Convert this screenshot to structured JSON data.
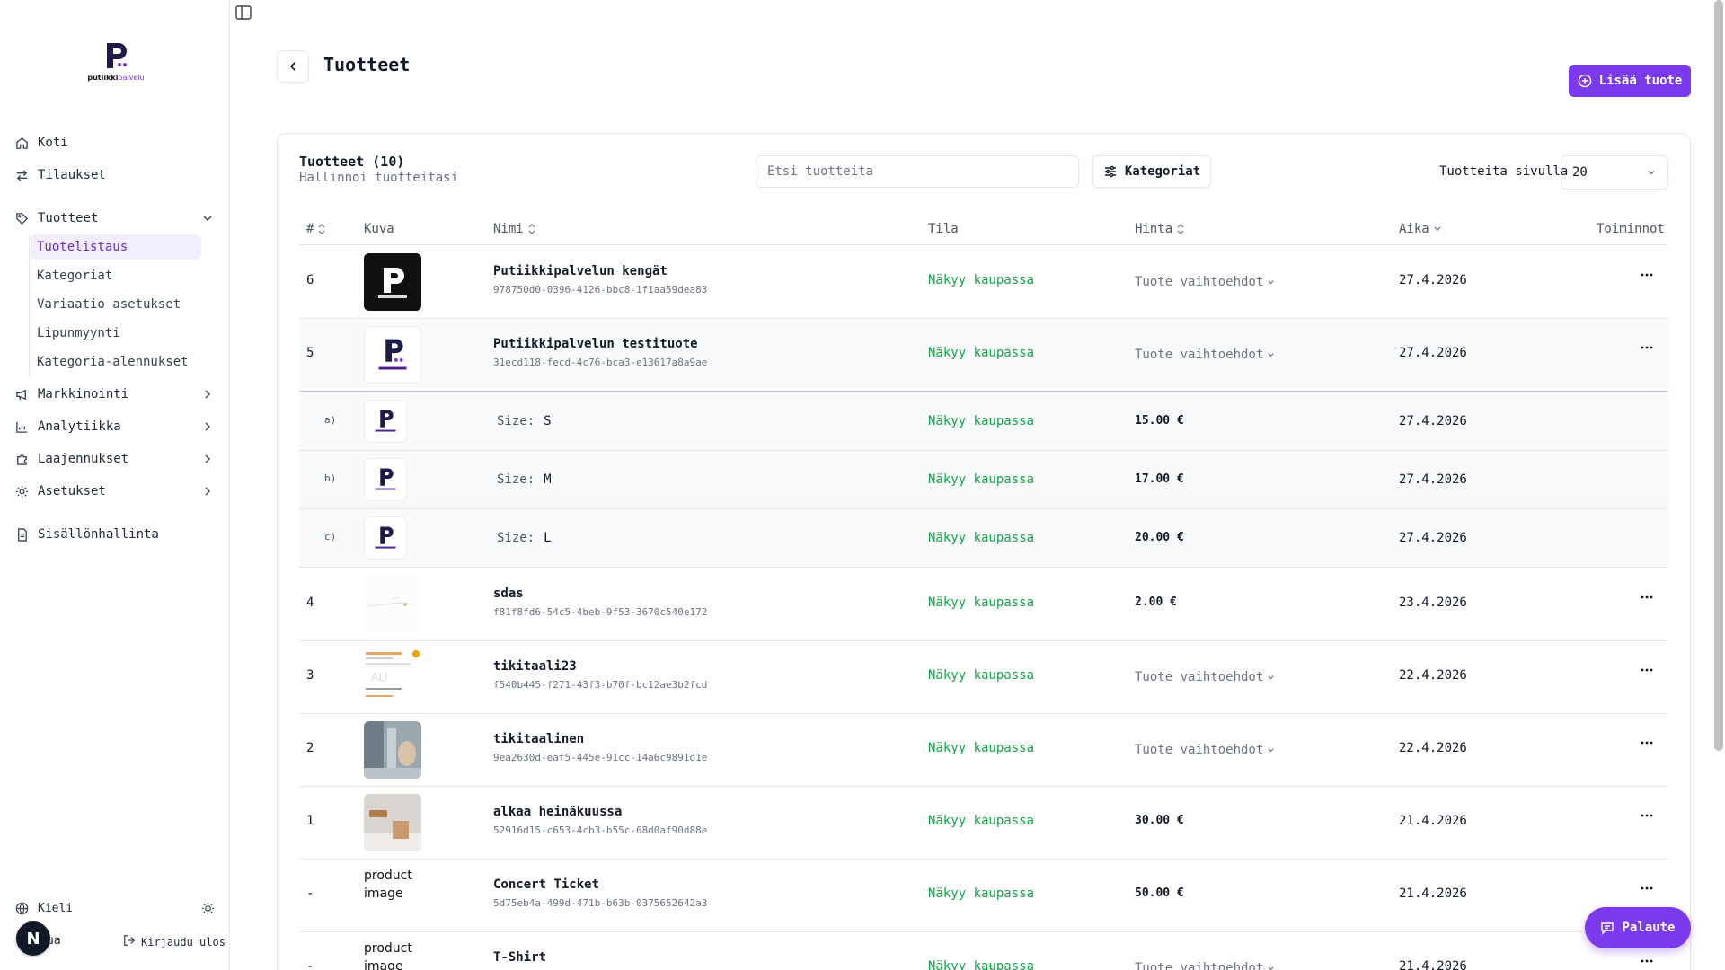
{
  "brand": {
    "logo_text_a": "putiikki",
    "logo_text_b": "palvelu"
  },
  "sidebar": {
    "items": [
      {
        "label": "Koti",
        "icon": "home-icon"
      },
      {
        "label": "Tilaukset",
        "icon": "arrows-icon"
      },
      {
        "label": "Tuotteet",
        "icon": "tag-icon"
      },
      {
        "label": "Markkinointi",
        "icon": "megaphone-icon"
      },
      {
        "label": "Analytiikka",
        "icon": "bar-chart-icon"
      },
      {
        "label": "Laajennukset",
        "icon": "puzzle-icon"
      },
      {
        "label": "Asetukset",
        "icon": "gear-icon"
      },
      {
        "label": "Sisällönhallinta",
        "icon": "document-icon"
      }
    ],
    "sub_items": [
      "Tuotelistaus",
      "Kategoriat",
      "Variaatio asetukset",
      "Lipunmyynti",
      "Kategoria-alennukset"
    ],
    "language_label": "Kieli",
    "user_label_partial": "ua",
    "logout_label": "Kirjaudu ulos",
    "avatar_letter": "N"
  },
  "header": {
    "title": "Tuotteet",
    "add_button": "Lisää tuote"
  },
  "card": {
    "title": "Tuotteet (10)",
    "subtitle": "Hallinnoi tuotteitasi",
    "search_placeholder": "Etsi tuotteita",
    "categories_button": "Kategoriat",
    "per_page_label": "Tuotteita sivulla",
    "per_page_value": "20"
  },
  "table": {
    "columns": [
      "#",
      "Kuva",
      "Nimi",
      "Tila",
      "Hinta",
      "Aika",
      "Toiminnot"
    ],
    "rows": [
      {
        "num": "6",
        "name": "Putiikkipalvelun kengät",
        "id": "978750d0-0396-4126-bbc8-1f1aa59dea83",
        "status": "Näkyy kaupassa",
        "price": "Tuote vaihtoehdot",
        "date": "27.4.2026"
      },
      {
        "num": "5",
        "name": "Putiikkipalvelun testituote",
        "id": "31ecd118-fecd-4c76-bca3-e13617a8a9ae",
        "status": "Näkyy kaupassa",
        "price": "Tuote vaihtoehdot",
        "date": "27.4.2026"
      },
      {
        "num": "4",
        "name": "sdas",
        "id": "f81f8fd6-54c5-4beb-9f53-3670c540e172",
        "status": "Näkyy kaupassa",
        "price": "2.00 €",
        "date": "23.4.2026"
      },
      {
        "num": "3",
        "name": "tikitaali23",
        "id": "f540b445-f271-43f3-b70f-bc12ae3b2fcd",
        "status": "Näkyy kaupassa",
        "price": "Tuote vaihtoehdot",
        "date": "22.4.2026"
      },
      {
        "num": "2",
        "name": "tikitaalinen",
        "id": "9ea2630d-eaf5-445e-91cc-14a6c9891d1e",
        "status": "Näkyy kaupassa",
        "price": "Tuote vaihtoehdot",
        "date": "22.4.2026"
      },
      {
        "num": "1",
        "name": "alkaa heinäkuussa",
        "id": "52916d15-c653-4cb3-b55c-68d0af90d88e",
        "status": "Näkyy kaupassa",
        "price": "30.00 €",
        "date": "21.4.2026"
      },
      {
        "num": "-",
        "name": "Concert Ticket",
        "id": "5d75eb4a-499d-471b-b63b-0375652642a3",
        "status": "Näkyy kaupassa",
        "price": "50.00 €",
        "date": "21.4.2026"
      },
      {
        "num": "-",
        "name": "T-Shirt",
        "id": "",
        "status": "Näkyy kaupassa",
        "price": "Tuote vaihtoehdot",
        "date": "21.4.2026"
      }
    ],
    "variants": [
      {
        "label": "a)",
        "size_label": "Size:",
        "size": "S",
        "status": "Näkyy kaupassa",
        "price": "15.00 €",
        "date": "27.4.2026"
      },
      {
        "label": "b)",
        "size_label": "Size:",
        "size": "M",
        "status": "Näkyy kaupassa",
        "price": "17.00 €",
        "date": "27.4.2026"
      },
      {
        "label": "c)",
        "size_label": "Size:",
        "size": "L",
        "status": "Näkyy kaupassa",
        "price": "20.00 €",
        "date": "27.4.2026"
      }
    ],
    "broken_image_alt": [
      "product",
      "image"
    ]
  },
  "feedback_button": "Palaute",
  "colors": {
    "accent": "#7c3aed",
    "status_green": "#16a34a"
  }
}
